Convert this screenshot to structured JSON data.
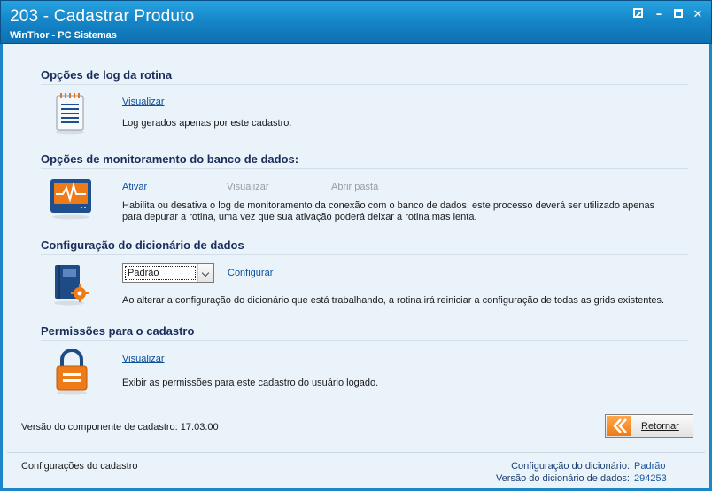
{
  "window": {
    "title": "203 - Cadastrar  Produto",
    "subtitle": "WinThor - PC Sistemas"
  },
  "sections": {
    "log": {
      "title": "Opções de log da rotina",
      "link": "Visualizar",
      "description": "Log gerados apenas por este cadastro."
    },
    "monitor": {
      "title": "Opções de monitoramento do banco de dados:",
      "link_activate": "Ativar",
      "link_view": "Visualizar",
      "link_open": "Abrir pasta",
      "description_line1": "Habilita ou desativa o log de monitoramento da conexão com o banco de dados, este processo deverá ser utilizado apenas",
      "description_line2": "para depurar a rotina, uma vez que sua ativação poderá deixar a rotina mas lenta."
    },
    "dictionary": {
      "title": "Configuração do dicionário de dados",
      "select_value": "Padrão",
      "link_configure": "Configurar",
      "description": "Ao alterar a configuração do dicionário que está trabalhando, a rotina irá reiniciar a configuração de todas as grids existentes."
    },
    "permissions": {
      "title": "Permissões para o cadastro",
      "link": "Visualizar",
      "description": "Exibir as permissões para este cadastro do usuário logado."
    }
  },
  "footer": {
    "version_text": "Versão do componente de cadastro: 17.03.00",
    "return_button": "Retornar",
    "status_left": "Configurações do cadastro",
    "dict_config_label": "Configuração do dicionário:",
    "dict_config_value": "Padrão",
    "dict_version_label": "Versão do dicionário de dados:",
    "dict_version_value": "294253"
  },
  "colors": {
    "title_bar": "#1587c9",
    "section_title": "#1a2c5a",
    "link": "#0b4f9c",
    "accent_orange": "#f07a12"
  }
}
